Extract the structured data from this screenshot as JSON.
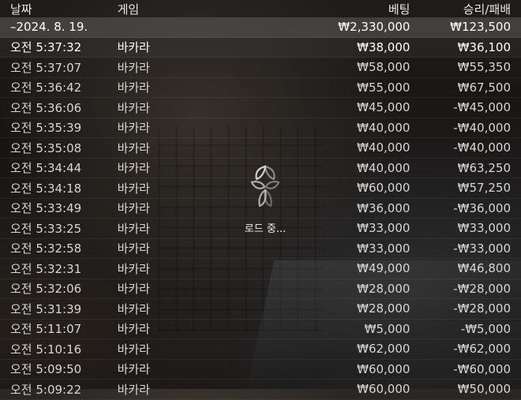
{
  "columns": {
    "date": "날짜",
    "game": "게임",
    "bet": "베팅",
    "win_loss": "승리/패배"
  },
  "summary": {
    "date": "–2024. 8. 19.",
    "bet": "₩2,330,000",
    "win_loss": "₩123,500"
  },
  "rows": [
    {
      "time": "오전 5:37:32",
      "game": "바카라",
      "bet": "₩38,000",
      "win_loss": "₩36,100"
    },
    {
      "time": "오전 5:37:07",
      "game": "바카라",
      "bet": "₩58,000",
      "win_loss": "₩55,350"
    },
    {
      "time": "오전 5:36:42",
      "game": "바카라",
      "bet": "₩55,000",
      "win_loss": "₩67,500"
    },
    {
      "time": "오전 5:36:06",
      "game": "바카라",
      "bet": "₩45,000",
      "win_loss": "-₩45,000"
    },
    {
      "time": "오전 5:35:39",
      "game": "바카라",
      "bet": "₩40,000",
      "win_loss": "-₩40,000"
    },
    {
      "time": "오전 5:35:08",
      "game": "바카라",
      "bet": "₩40,000",
      "win_loss": "-₩40,000"
    },
    {
      "time": "오전 5:34:44",
      "game": "바카라",
      "bet": "₩40,000",
      "win_loss": "₩63,250"
    },
    {
      "time": "오전 5:34:18",
      "game": "바카라",
      "bet": "₩60,000",
      "win_loss": "₩57,250"
    },
    {
      "time": "오전 5:33:49",
      "game": "바카라",
      "bet": "₩36,000",
      "win_loss": "-₩36,000"
    },
    {
      "time": "오전 5:33:25",
      "game": "바카라",
      "bet": "₩33,000",
      "win_loss": "₩33,000"
    },
    {
      "time": "오전 5:32:58",
      "game": "바카라",
      "bet": "₩33,000",
      "win_loss": "-₩33,000"
    },
    {
      "time": "오전 5:32:31",
      "game": "바카라",
      "bet": "₩49,000",
      "win_loss": "₩46,800"
    },
    {
      "time": "오전 5:32:06",
      "game": "바카라",
      "bet": "₩28,000",
      "win_loss": "-₩28,000"
    },
    {
      "time": "오전 5:31:39",
      "game": "바카라",
      "bet": "₩28,000",
      "win_loss": "-₩28,000"
    },
    {
      "time": "오전 5:11:07",
      "game": "바카라",
      "bet": "₩5,000",
      "win_loss": "-₩5,000"
    },
    {
      "time": "오전 5:10:16",
      "game": "바카라",
      "bet": "₩62,000",
      "win_loss": "-₩62,000"
    },
    {
      "time": "오전 5:09:50",
      "game": "바카라",
      "bet": "₩60,000",
      "win_loss": "-₩60,000"
    },
    {
      "time": "오전 5:09:22",
      "game": "바카라",
      "bet": "₩60,000",
      "win_loss": "₩50,000"
    }
  ],
  "loader": {
    "text": "로드 중...",
    "icon": "spinner-icon"
  }
}
